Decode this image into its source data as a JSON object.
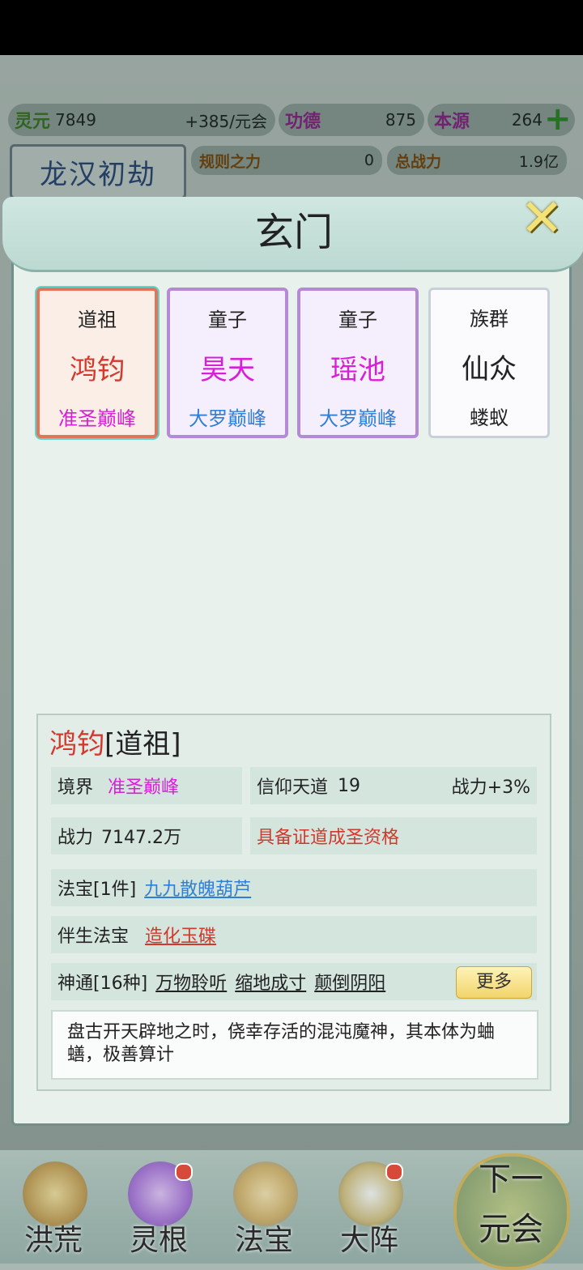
{
  "resources": {
    "lingyuan_label": "灵元",
    "lingyuan_value": "7849",
    "lingyuan_rate": "+385/元会",
    "gongde_label": "功德",
    "gongde_value": "875",
    "benyuan_label": "本源",
    "benyuan_value": "264",
    "plus_icon": "plus-icon"
  },
  "era": {
    "name": "龙汉初劫"
  },
  "rules": {
    "rule_label": "规则之力",
    "rule_value": "0",
    "power_label": "总战力",
    "power_value": "1.9亿"
  },
  "modal": {
    "title": "玄门",
    "close_icon": "close-icon",
    "cards": [
      {
        "role": "道祖",
        "name": "鸿钧",
        "rank": "准圣巅峰",
        "name_color": "#d2382c",
        "rank_color": "#d81fd8",
        "style": "red"
      },
      {
        "role": "童子",
        "name": "昊天",
        "rank": "大罗巅峰",
        "name_color": "#d81fd8",
        "rank_color": "#2f7fd6",
        "style": "purple"
      },
      {
        "role": "童子",
        "name": "瑶池",
        "rank": "大罗巅峰",
        "name_color": "#d81fd8",
        "rank_color": "#2f7fd6",
        "style": "purple"
      },
      {
        "role": "族群",
        "name": "仙众",
        "rank": "蝼蚁",
        "name_color": "#222222",
        "rank_color": "#222222",
        "style": "white"
      }
    ],
    "info": {
      "name": "鸿钧",
      "title_suffix": "[道祖]",
      "realm_label": "境界",
      "realm_value": "准圣巅峰",
      "faith_label": "信仰天道",
      "faith_value": "19",
      "power_bonus": "战力+3%",
      "power_label": "战力",
      "power_value": "7147.2万",
      "qualification": "具备证道成圣资格",
      "treasure_label": "法宝[1件]",
      "treasure_item": "九九散魄葫芦",
      "companion_label": "伴生法宝",
      "companion_item": "造化玉碟",
      "skills_label": "神通[16种]",
      "skills": [
        "万物聆听",
        "缩地成寸",
        "颠倒阴阳"
      ],
      "more_label": "更多",
      "description": "盘古开天辟地之时，侥幸存活的混沌魔神，其本体为蛐蟮，极善算计"
    }
  },
  "nav": {
    "items": [
      {
        "label": "洪荒",
        "icon": "mountain-icon"
      },
      {
        "label": "灵根",
        "icon": "lotus-icon"
      },
      {
        "label": "法宝",
        "icon": "treasure-icon"
      },
      {
        "label": "大阵",
        "icon": "formation-icon"
      }
    ],
    "next_line1": "下一",
    "next_line2": "元会"
  }
}
